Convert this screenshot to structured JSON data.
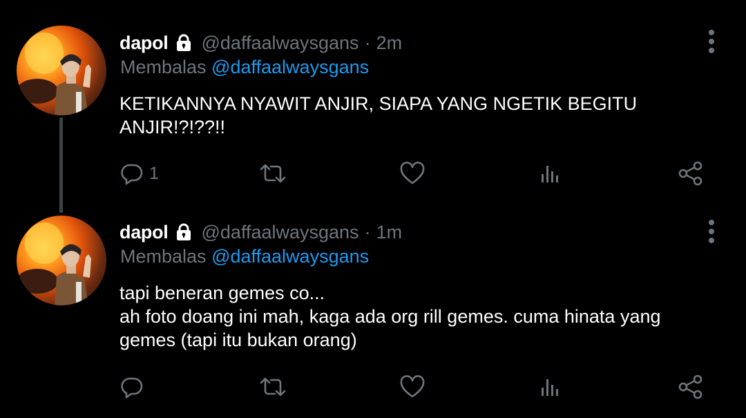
{
  "colors": {
    "background": "#000000",
    "text": "#ffffff",
    "muted": "#6e767d",
    "link": "#1d9bf0",
    "thread_line": "#3e4144"
  },
  "icons": {
    "lock": "lock-icon",
    "more": "more-vertical-icon",
    "reply": "reply-bubble-icon",
    "retweet": "retweet-icon",
    "like": "heart-icon",
    "views": "analytics-bars-icon",
    "share": "share-icon"
  },
  "tweets": [
    {
      "name": "dapol",
      "handle": "@daffaalwaysgans",
      "separator": "·",
      "time": "2m",
      "reply_prefix": "Membalas",
      "reply_to": "@daffaalwaysgans",
      "text_lines": [
        "KETIKANNYA NYAWIT ANJIR, SIAPA YANG NGETIK BEGITU",
        "ANJIR!?!??!!"
      ],
      "reply_count": "1"
    },
    {
      "name": "dapol",
      "handle": "@daffaalwaysgans",
      "separator": "·",
      "time": "1m",
      "reply_prefix": "Membalas",
      "reply_to": "@daffaalwaysgans",
      "text_lines": [
        "tapi beneran gemes co...",
        "ah foto doang ini mah, kaga ada org rill gemes. cuma hinata yang",
        "gemes (tapi itu bukan orang)"
      ],
      "reply_count": ""
    }
  ]
}
